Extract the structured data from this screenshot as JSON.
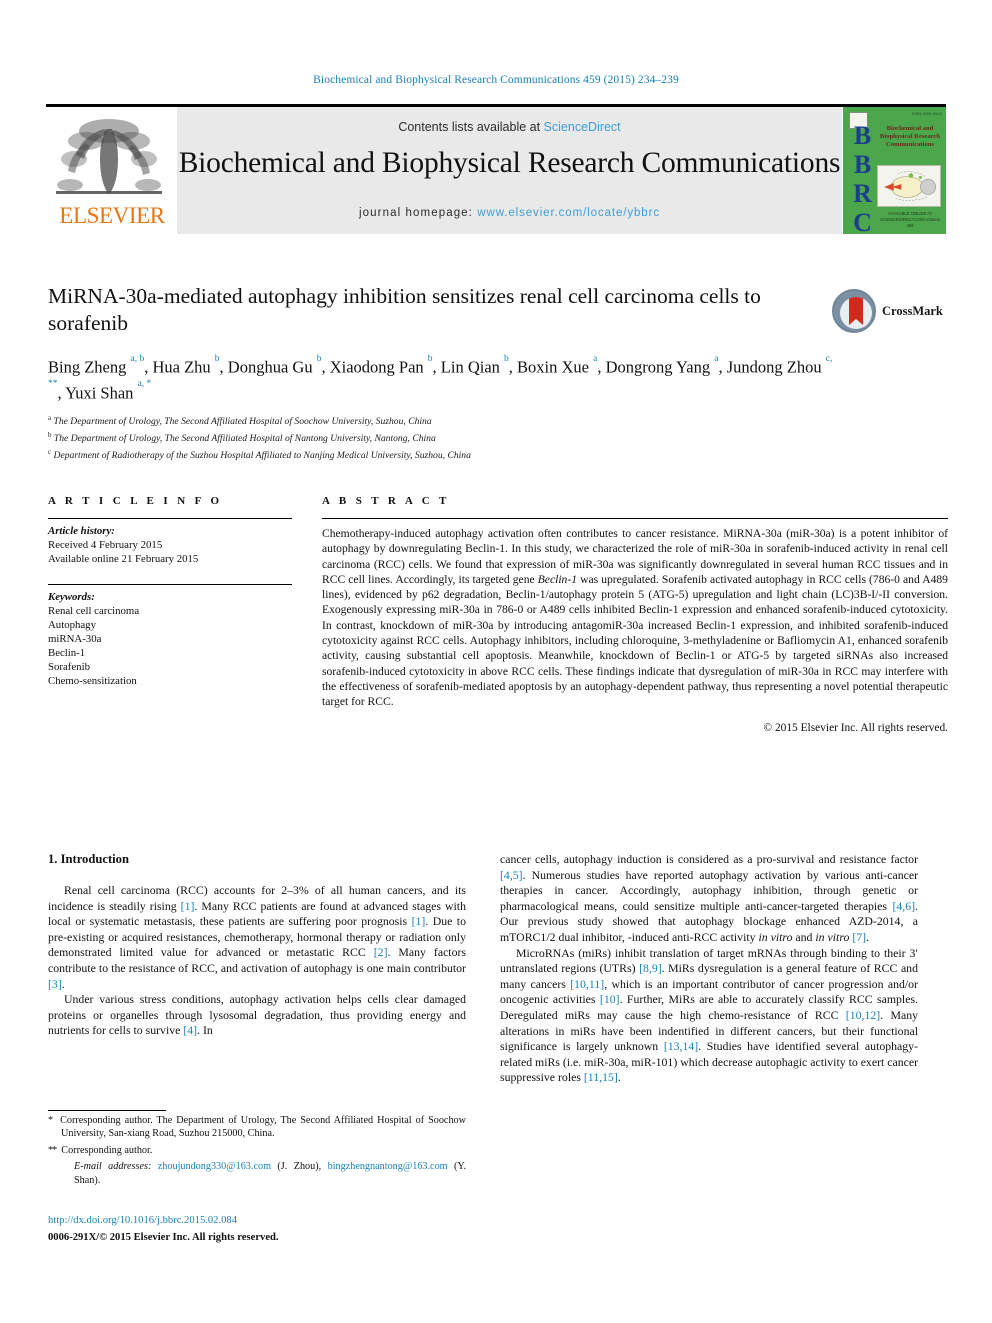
{
  "running_head": "Biochemical and Biophysical Research Communications 459 (2015) 234–239",
  "masthead": {
    "publisher": "ELSEVIER",
    "contents_prefix": "Contents lists available at ",
    "contents_link": "ScienceDirect",
    "journal_title": "Biochemical and Biophysical Research Communications",
    "homepage_label": "journal homepage: ",
    "homepage_url": "www.elsevier.com/locate/ybbrc",
    "cover": {
      "acronym": "BBRC",
      "title_lines": "Biochemical and Biophysical Research Communications",
      "top_right": "ISSN 0006-291X",
      "bottom_text": "AVAILABLE ONLINE AT SCIENCEDIRECT.COM  Volume 459",
      "background_color": "#4ca64c",
      "acronym_color": "#1b3f8b"
    }
  },
  "article": {
    "title": "MiRNA-30a-mediated autophagy inhibition sensitizes renal cell carcinoma cells to sorafenib",
    "authors_html": "Bing Zheng <sup>a, b</sup>, Hua Zhu <sup>b</sup>, Donghua Gu <sup>b</sup>, Xiaodong Pan <sup>b</sup>, Lin Qian <sup>b</sup>, Boxin Xue <sup>a</sup>, Dongrong Yang <sup>a</sup>, Jundong Zhou <sup>c, **</sup>, Yuxi Shan <sup>a, *</sup>",
    "affiliations": [
      {
        "marker": "a",
        "text": "The Department of Urology, The Second Affiliated Hospital of Soochow University, Suzhou, China"
      },
      {
        "marker": "b",
        "text": "The Department of Urology, The Second Affiliated Hospital of Nantong University, Nantong, China"
      },
      {
        "marker": "c",
        "text": "Department of Radiotherapy of the Suzhou Hospital Affiliated to Nanjing Medical University, Suzhou, China"
      }
    ],
    "crossmark_label": "CrossMark"
  },
  "article_info": {
    "heading": "A R T I C L E   I N F O",
    "history_label": "Article history:",
    "history": [
      "Received 4 February 2015",
      "Available online 21 February 2015"
    ],
    "keywords_label": "Keywords:",
    "keywords": [
      "Renal cell carcinoma",
      "Autophagy",
      "miRNA-30a",
      "Beclin-1",
      "Sorafenib",
      "Chemo-sensitization"
    ]
  },
  "abstract": {
    "heading": "A B S T R A C T",
    "text_html": "Chemotherapy-induced autophagy activation often contributes to cancer resistance. MiRNA-30a (miR-30a) is a potent inhibitor of autophagy by downregulating Beclin-1. In this study, we characterized the role of miR-30a in sorafenib-induced activity in renal cell carcinoma (RCC) cells. We found that expression of miR-30a was significantly downregulated in several human RCC tissues and in RCC cell lines. Accordingly, its targeted gene <i>Beclin-1</i> was upregulated. Sorafenib activated autophagy in RCC cells (786-0 and A489 lines), evidenced by p62 degradation, Beclin-1/autophagy protein 5 (ATG-5) upregulation and light chain (LC)3B-I/-II conversion. Exogenously expressing miR-30a in 786-0 or A489 cells inhibited Beclin-1 expression and enhanced sorafenib-induced cytotoxicity. In contrast, knockdown of miR-30a by introducing antagomiR-30a increased Beclin-1 expression, and inhibited sorafenib-induced cytotoxicity against RCC cells. Autophagy inhibitors, including chloroquine, 3-methyladenine or Bafliomycin A1, enhanced sorafenib activity, causing substantial cell apoptosis. Meanwhile, knockdown of Beclin-1 or ATG-5 by targeted siRNAs also increased sorafenib-induced cytotoxicity in above RCC cells. These findings indicate that dysregulation of miR-30a in RCC may interfere with the effectiveness of sorafenib-mediated apoptosis by an autophagy-dependent pathway, thus representing a novel potential therapeutic target for RCC.",
    "copyright": "© 2015 Elsevier Inc. All rights reserved."
  },
  "introduction": {
    "section_number_title": "1.  Introduction",
    "left_paragraphs_html": [
      "Renal cell carcinoma (RCC) accounts for 2–3% of all human cancers, and its incidence is steadily rising <span class=\"ref\">[1]</span>. Many RCC patients are found at advanced stages with local or systematic metastasis, these patients are suffering poor prognosis <span class=\"ref\">[1]</span>. Due to pre-existing or acquired resistances, chemotherapy, hormonal therapy or radiation only demonstrated limited value for advanced or metastatic RCC <span class=\"ref\">[2]</span>. Many factors contribute to the resistance of RCC, and activation of autophagy is one main contributor <span class=\"ref\">[3]</span>.",
      "Under various stress conditions, autophagy activation helps cells clear damaged proteins or organelles through lysosomal degradation, thus providing energy and nutrients for cells to survive <span class=\"ref\">[4]</span>. In"
    ],
    "right_paragraphs_html": [
      "cancer cells, autophagy induction is considered as a pro-survival and resistance factor <span class=\"ref\">[4,5]</span>. Numerous studies have reported autophagy activation by various anti-cancer therapies in cancer. Accordingly, autophagy inhibition, through genetic or pharmacological means, could sensitize multiple anti-cancer-targeted therapies <span class=\"ref\">[4,6]</span>. Our previous study showed that autophagy blockage enhanced AZD-2014, a mTORC1/2 dual inhibitor, -induced anti-RCC activity <i>in vitro</i> and <i>in vitro</i> <span class=\"ref\">[7]</span>.",
      "MicroRNAs (miRs) inhibit translation of target mRNAs through binding to their 3′ untranslated regions (UTRs) <span class=\"ref\">[8,9]</span>. MiRs dysregulation is a general feature of RCC and many cancers <span class=\"ref\">[10,11]</span>, which is an important contributor of cancer progression and/or oncogenic activities <span class=\"ref\">[10]</span>. Further, MiRs are able to accurately classify RCC samples. Deregulated miRs may cause the high chemo-resistance of RCC <span class=\"ref\">[10,12]</span>. Many alterations in miRs have been indentified in different cancers, but their functional significance is largely unknown <span class=\"ref\">[13,14]</span>. Studies have identified several autophagy-related miRs (i.e. miR-30a, miR-101) which decrease autophagic activity to exert cancer suppressive roles <span class=\"ref\">[11,15]</span>."
    ]
  },
  "footnotes": {
    "items_html": [
      "<span class=\"star\">*</span>&nbsp; Corresponding author. The Department of Urology, The Second Affiliated Hospital of Soochow University, San-xiang Road, Suzhou 215000, China.",
      "<span class=\"star\">**</span>&nbsp; Corresponding author.",
      "<i>E-mail addresses:</i> <span class=\"mail\">zhoujundong330@163.com</span> (J. Zhou), <span class=\"mail\">bingzhengnantong@163.com</span> (Y. Shan)."
    ],
    "doi": "http://dx.doi.org/10.1016/j.bbrc.2015.02.084",
    "issn_line": "0006-291X/© 2015 Elsevier Inc. All rights reserved."
  },
  "colors": {
    "link_blue": "#1a7fb5",
    "sciencedirect_blue": "#3e9dd4",
    "elsevier_orange": "#e87511",
    "cover_green": "#4ca64c",
    "crossmark_red": "#cf2a1b"
  }
}
